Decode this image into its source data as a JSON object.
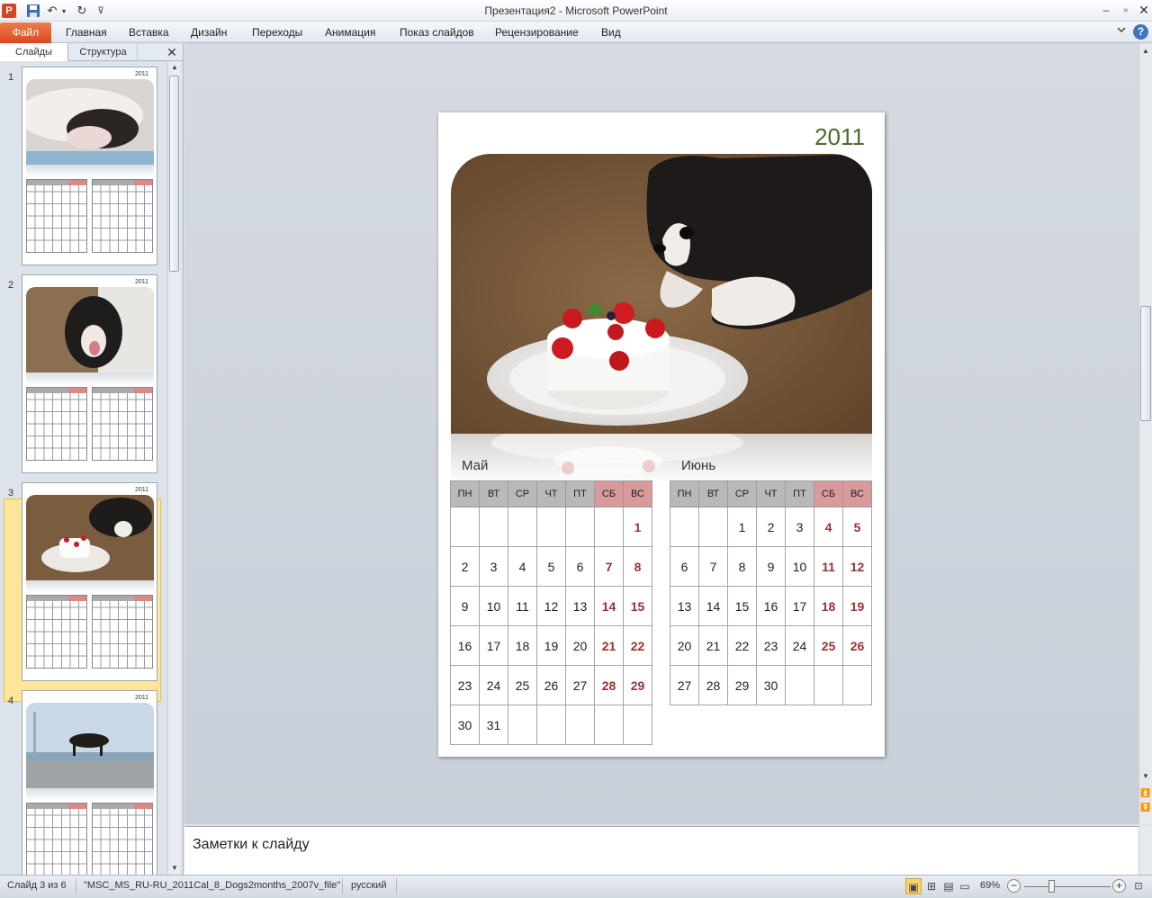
{
  "window": {
    "title": "Презентация2  -  Microsoft PowerPoint",
    "app_icon": "P",
    "minimize": "–",
    "maximize": "▫",
    "close": "✕"
  },
  "quick_access": {
    "save_icon": "💾",
    "undo_icon": "↶",
    "undo_drop": "▾",
    "redo_icon": "↻",
    "more_icon": "⊽"
  },
  "ribbon": {
    "file_tab": "Файл",
    "tabs": [
      "Главная",
      "Вставка",
      "Дизайн",
      "Переходы",
      "Анимация",
      "Показ слайдов",
      "Рецензирование",
      "Вид"
    ],
    "minimize_icon": "♡",
    "help_icon": "?"
  },
  "left_panel": {
    "tab_slides": "Слайды",
    "tab_outline": "Структура",
    "close_icon": "✕",
    "scroll_up": "▲",
    "scroll_down": "▼",
    "slides": [
      {
        "number": "1",
        "year": "2011",
        "selected": false
      },
      {
        "number": "2",
        "year": "2011",
        "selected": false
      },
      {
        "number": "3",
        "year": "2011",
        "selected": true
      },
      {
        "number": "4",
        "year": "2011",
        "selected": false
      }
    ]
  },
  "slide": {
    "year": "2011",
    "months": [
      {
        "name": "Май",
        "weekdays": [
          "ПН",
          "ВТ",
          "СР",
          "ЧТ",
          "ПТ",
          "СБ",
          "ВС"
        ],
        "weeks": [
          [
            "",
            "",
            "",
            "",
            "",
            "",
            "1"
          ],
          [
            "2",
            "3",
            "4",
            "5",
            "6",
            "7",
            "8"
          ],
          [
            "9",
            "10",
            "11",
            "12",
            "13",
            "14",
            "15"
          ],
          [
            "16",
            "17",
            "18",
            "19",
            "20",
            "21",
            "22"
          ],
          [
            "23",
            "24",
            "25",
            "26",
            "27",
            "28",
            "29"
          ],
          [
            "30",
            "31",
            "",
            "",
            "",
            "",
            ""
          ]
        ]
      },
      {
        "name": "Июнь",
        "weekdays": [
          "ПН",
          "ВТ",
          "СР",
          "ЧТ",
          "ПТ",
          "СБ",
          "ВС"
        ],
        "weeks": [
          [
            "",
            "",
            "1",
            "2",
            "3",
            "4",
            "5"
          ],
          [
            "6",
            "7",
            "8",
            "9",
            "10",
            "11",
            "12"
          ],
          [
            "13",
            "14",
            "15",
            "16",
            "17",
            "18",
            "19"
          ],
          [
            "20",
            "21",
            "22",
            "23",
            "24",
            "25",
            "26"
          ],
          [
            "27",
            "28",
            "29",
            "30",
            "",
            "",
            ""
          ]
        ]
      }
    ],
    "weekend_color": "#993234",
    "year_color": "#4b6b2b"
  },
  "edit_scroll": {
    "up": "▲",
    "down": "▼",
    "prev_slide": "⏫",
    "next_slide": "⏬"
  },
  "notes": {
    "placeholder": "Заметки к слайду"
  },
  "statusbar": {
    "slide_info": "Слайд 3 из 6",
    "theme": "\"MSC_MS_RU-RU_2011Cal_8_Dogs2months_2007v_file\"",
    "language": "русский",
    "view_icons": [
      "▣",
      "⊞",
      "▤",
      "▭"
    ],
    "zoom": "69%",
    "zoom_out": "−",
    "zoom_in": "+",
    "fit_icon": "⊡"
  }
}
